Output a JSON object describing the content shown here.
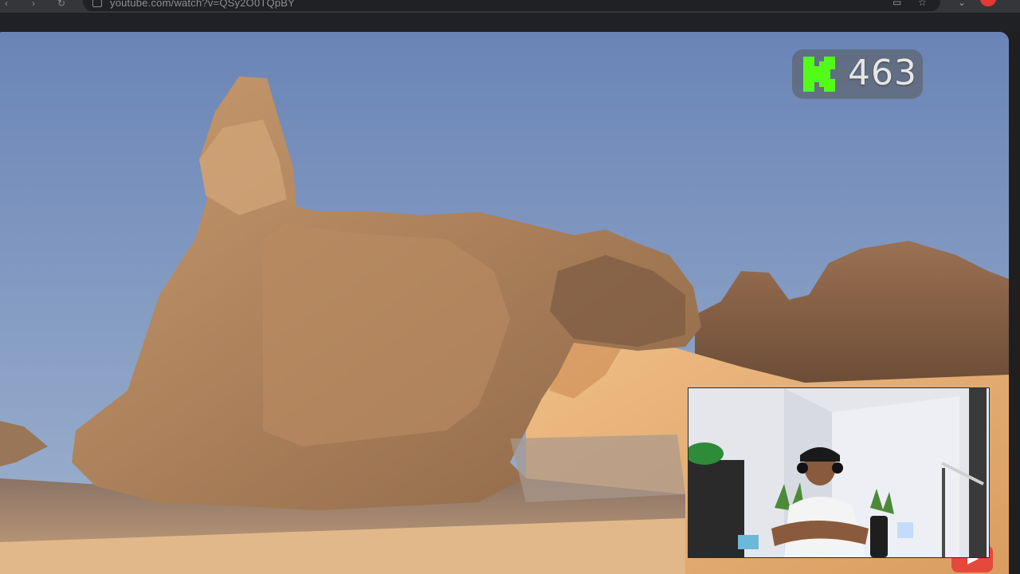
{
  "browser": {
    "address_text": "youtube.com/watch?v=QSy2O0TQpBY"
  },
  "stream": {
    "viewer_count": "463",
    "platform_logo": "kick-logo",
    "accent_color": "#53fc18"
  },
  "icons": {
    "back": "back-arrow-icon",
    "forward": "forward-arrow-icon",
    "reload": "reload-icon",
    "youtube": "youtube-icon"
  }
}
